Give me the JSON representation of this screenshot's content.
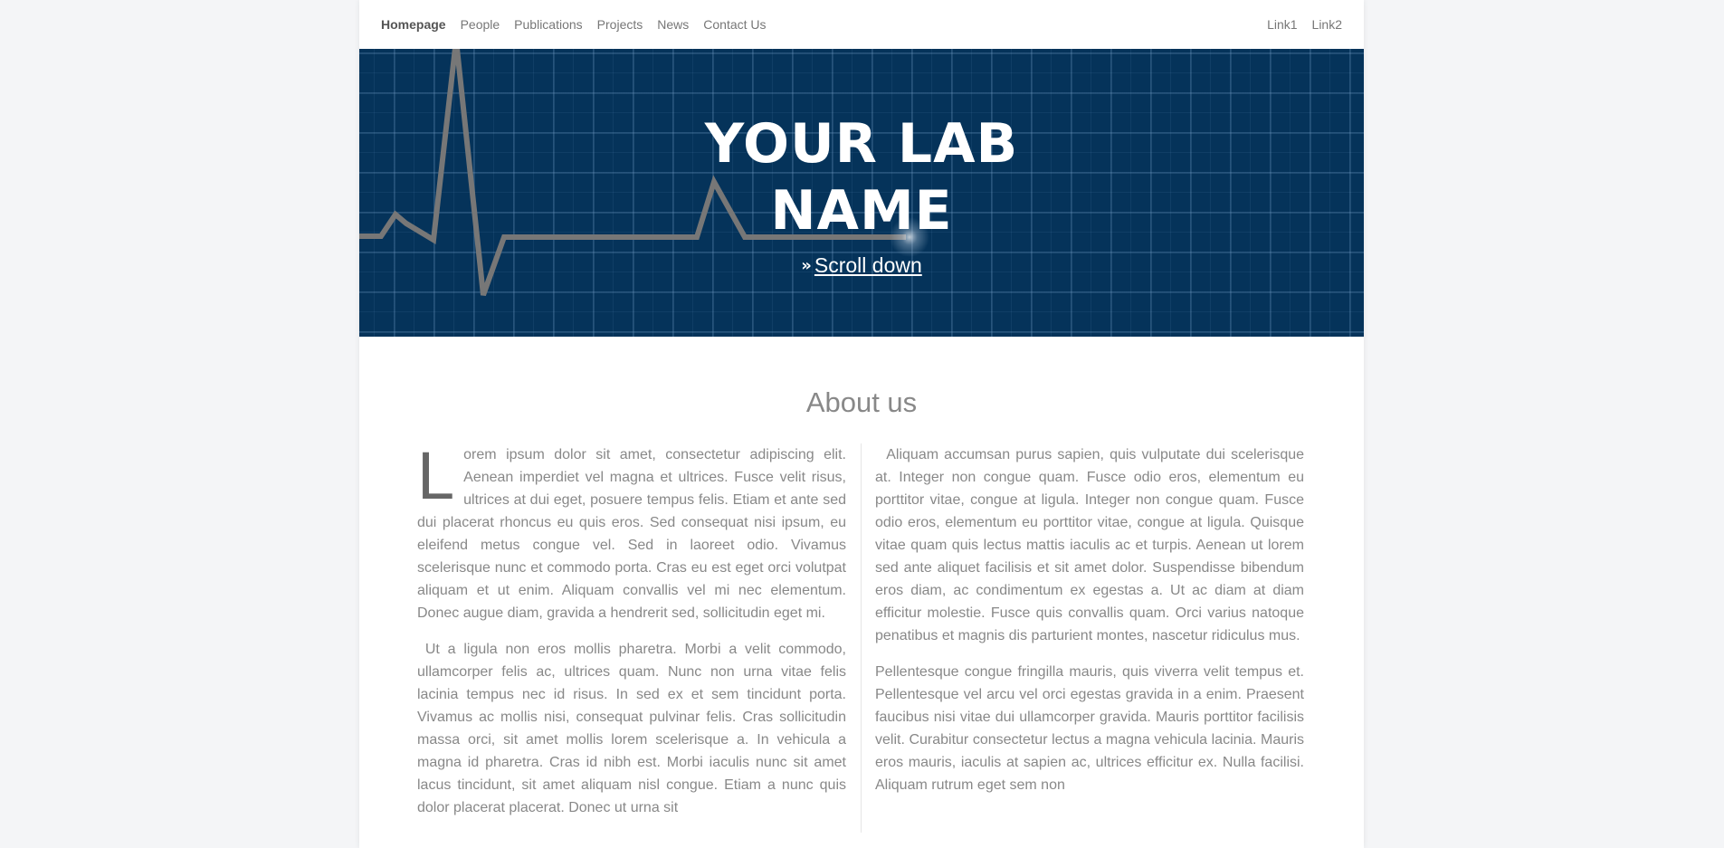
{
  "nav": {
    "left_items": [
      "Homepage",
      "People",
      "Publications",
      "Projects",
      "News",
      "Contact Us"
    ],
    "right_items": [
      "Link1",
      "Link2"
    ]
  },
  "hero": {
    "title_line1": "YOUR LAB",
    "title_line2": "NAME",
    "scroll_icon": "double-chevron-down-icon",
    "scroll_label": "Scroll down"
  },
  "about": {
    "heading": "About us",
    "dropcap": "L",
    "left_p1": "orem ipsum dolor sit amet, consectetur adipiscing elit. Aenean imperdiet vel magna et ultrices. Fusce velit risus, ultrices at dui eget, posuere tempus felis. Etiam et ante sed dui placerat rhoncus eu quis eros. Sed consequat nisi ipsum, eu eleifend metus congue vel. Sed in laoreet odio. Vivamus scelerisque nunc et commodo porta. Cras eu est eget orci volutpat aliquam et ut enim. Aliquam convallis vel mi nec elementum. Donec augue diam, gravida a hendrerit sed, sollicitudin eget mi.",
    "left_p2": "Ut a ligula non eros mollis pharetra. Morbi a velit commodo, ullamcorper felis ac, ultrices quam. Nunc non urna vitae felis lacinia tempus nec id risus. In sed ex et sem tincidunt porta. Vivamus ac mollis nisi, consequat pulvinar felis. Cras sollicitudin massa orci, sit amet mollis lorem scelerisque a. In vehicula a magna id pharetra. Cras id nibh est. Morbi iaculis nunc sit amet lacus tincidunt, sit amet aliquam nisl congue. Etiam a nunc quis dolor placerat placerat. Donec ut urna sit",
    "right_p1": "Aliquam accumsan purus sapien, quis vulputate dui scelerisque at. Integer non congue quam. Fusce odio eros, elementum eu porttitor vitae, congue at ligula. Integer non congue quam. Fusce odio eros, elementum eu porttitor vitae, congue at ligula. Quisque vitae quam quis lectus mattis iaculis ac et turpis. Aenean ut lorem sed ante aliquet facilisis et sit amet dolor. Suspendisse bibendum eros diam, ac condimentum ex egestas a. Ut ac diam at diam efficitur molestie. Fusce quis convallis quam. Orci varius natoque penatibus et magnis dis parturient montes, nascetur ridiculus mus.",
    "right_p2": "Pellentesque congue fringilla mauris, quis viverra velit tempus et. Pellentesque vel arcu vel orci egestas gravida in a enim. Praesent faucibus nisi vitae dui ullamcorper gravida. Mauris porttitor facilisis velit. Curabitur consectetur lectus a magna vehicula lacinia. Mauris eros mauris, iaculis at sapien ac, ultrices efficitur ex. Nulla facilisi. Aliquam rutrum eget sem non"
  },
  "colors": {
    "hero_background": "#05335a",
    "ecg_line": "#777777",
    "text_gray": "#888888"
  }
}
